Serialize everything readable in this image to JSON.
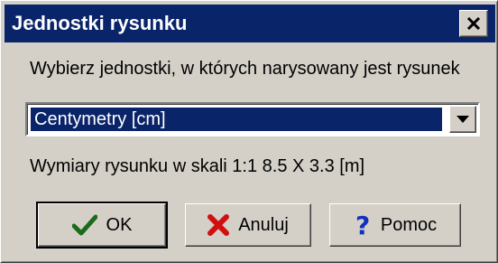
{
  "window": {
    "title": "Jednostki rysunku"
  },
  "dialog": {
    "instruction": "Wybierz jednostki, w których narysowany jest rysunek",
    "units_select": {
      "selected": "Centymetry [cm]"
    },
    "dimensions_text": "Wymiary rysunku w skali 1:1  8.5 X 3.3 [m]"
  },
  "buttons": {
    "ok": "OK",
    "cancel": "Anuluj",
    "help": "Pomoc"
  },
  "icons": {
    "close": "close-icon",
    "dropdown": "chevron-down-icon",
    "ok": "checkmark-icon",
    "cancel": "red-x-icon",
    "help": "question-mark-icon"
  },
  "colors": {
    "titlebar": "#0a246a",
    "selection": "#0a246a",
    "ok_check": "#1a6b1a",
    "cancel_x": "#d01010",
    "help_q": "#1030c0"
  }
}
